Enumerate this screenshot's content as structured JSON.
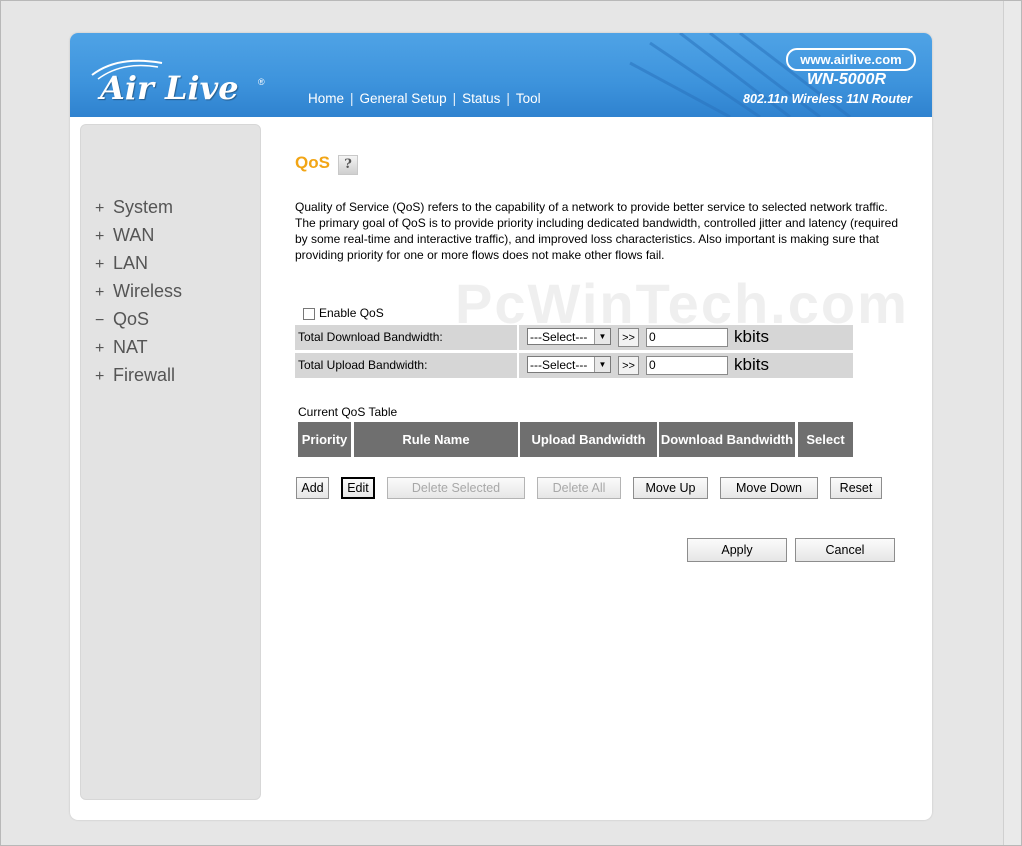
{
  "header": {
    "logo": "Air Live",
    "logo_reg": "®",
    "nav": [
      "Home",
      "General Setup",
      "Status",
      "Tool"
    ],
    "url": "www.airlive.com",
    "model": "WN-5000R",
    "subtitle": "802.11n Wireless 11N Router"
  },
  "sidebar": {
    "items": [
      {
        "marker": "+",
        "label": "System"
      },
      {
        "marker": "+",
        "label": "WAN"
      },
      {
        "marker": "+",
        "label": "LAN"
      },
      {
        "marker": "+",
        "label": "Wireless"
      },
      {
        "marker": "−",
        "label": "QoS"
      },
      {
        "marker": "+",
        "label": "NAT"
      },
      {
        "marker": "+",
        "label": "Firewall"
      }
    ]
  },
  "page": {
    "title": "QoS",
    "description": "Quality of Service (QoS) refers to the capability of a network to provide better service to selected network traffic. The primary goal of QoS is to provide priority including dedicated bandwidth, controlled jitter and latency (required by some real-time and interactive traffic), and improved loss characteristics. Also important is making sure that providing priority for one or more flows does not make other flows fail.",
    "watermark": "PcWinTech.com",
    "enable_qos_label": "Enable QoS",
    "enable_qos_checked": false
  },
  "bandwidth": {
    "download": {
      "label": "Total Download Bandwidth:",
      "select": "---Select---",
      "go": ">>",
      "value": "0",
      "unit": "kbits"
    },
    "upload": {
      "label": "Total Upload Bandwidth:",
      "select": "---Select---",
      "go": ">>",
      "value": "0",
      "unit": "kbits"
    }
  },
  "qos_table": {
    "caption": "Current QoS Table",
    "headers": [
      "Priority",
      "Rule Name",
      "Upload Bandwidth",
      "Download Bandwidth",
      "Select"
    ]
  },
  "buttons": {
    "add": "Add",
    "edit": "Edit",
    "delete_selected": "Delete Selected",
    "delete_all": "Delete All",
    "move_up": "Move Up",
    "move_down": "Move Down",
    "reset": "Reset",
    "apply": "Apply",
    "cancel": "Cancel"
  },
  "colors": {
    "header_blue": "#3d93dc",
    "title_orange": "#f2a515",
    "table_header": "#6f6f6f"
  }
}
